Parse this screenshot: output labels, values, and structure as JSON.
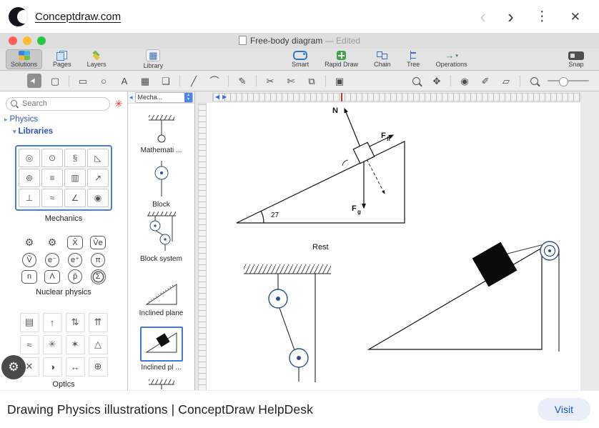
{
  "topbar": {
    "site": "Conceptdraw.com"
  },
  "icons": {
    "back": "‹",
    "forward": "›",
    "menu": "⋮",
    "close": "✕",
    "store": "✳",
    "gear": "⚙",
    "caret_right": "▸",
    "caret_down": "▾",
    "panel_left": "◂",
    "stepper_up": "▲",
    "stepper_down": "▼",
    "ruler_left": "◀",
    "ruler_right": "▶",
    "library_grid": "▦",
    "operations_arrow": "→",
    "dropdown_chevron": "▾"
  },
  "titlebar": {
    "title": "Free-body diagram",
    "edited": "— Edited"
  },
  "toolbar1": {
    "solutions": "Solutions",
    "pages": "Pages",
    "layers": "Layers",
    "library": "Library",
    "smart": "Smart",
    "rapid_draw": "Rapid Draw",
    "chain": "Chain",
    "tree": "Tree",
    "operations": "Operations",
    "snap": "Snap"
  },
  "toolbar2": {
    "glyphs": {
      "select": "➤",
      "marquee": "▢",
      "rect": "▭",
      "oval": "○",
      "text": "A",
      "grid": "▦",
      "comment": "❏",
      "line": "╱",
      "curve": "⌒",
      "pen": "✎",
      "scissors": "✂",
      "knife": "✄",
      "combine": "⧉",
      "camera": "▣",
      "pan": "✥",
      "stamp": "◉",
      "brush": "✐",
      "eraser": "▱"
    }
  },
  "sidebar": {
    "search_placeholder": "Search",
    "tree": {
      "physics": "Physics",
      "libraries": "Libraries"
    },
    "mechanics": {
      "label": "Mechanics",
      "icons": [
        "◎",
        "⊙",
        "§",
        "◺",
        "⊚",
        "≡",
        "▥",
        "↗",
        "⊥",
        "≈",
        "∠",
        "◉"
      ]
    },
    "nuclear": {
      "label": "Nuclear physics",
      "cells": [
        {
          "g": "⚙",
          "c": "ncell plain"
        },
        {
          "g": "⚙",
          "c": "ncell plain"
        },
        {
          "g": "X̂",
          "c": "ncell box"
        },
        {
          "g": "V̂e",
          "c": "ncell box"
        },
        {
          "g": "Ṽ",
          "c": "ncell circle"
        },
        {
          "g": "e⁻",
          "c": "ncell circle"
        },
        {
          "g": "e⁺",
          "c": "ncell circle"
        },
        {
          "g": "π",
          "c": "ncell circle"
        },
        {
          "g": "n",
          "c": "ncell box"
        },
        {
          "g": "Λ",
          "c": "ncell box"
        },
        {
          "g": "p̄",
          "c": "ncell circle"
        },
        {
          "g": "Σ",
          "c": "ncell ring"
        }
      ]
    },
    "optics": {
      "label": "Optics",
      "icons": [
        "▤",
        "↑",
        "⇅",
        "⇈",
        "≈",
        "✳",
        "✶",
        "△",
        "✕",
        "◑",
        "↔",
        "⊕"
      ]
    }
  },
  "panel": {
    "selector": "Mecha...",
    "items": [
      "Mathemati ...",
      "Block",
      "Block system",
      "Inclined plane",
      "Inclined pl ..."
    ]
  },
  "canvas": {
    "labels": {
      "n": "N",
      "f1": "F",
      "fr": "fr",
      "f2": "F",
      "g": "g",
      "angle": "27",
      "rest": "Rest"
    }
  },
  "footer": {
    "title": "Drawing Physics illustrations | ConceptDraw HelpDesk",
    "visit": "Visit"
  }
}
